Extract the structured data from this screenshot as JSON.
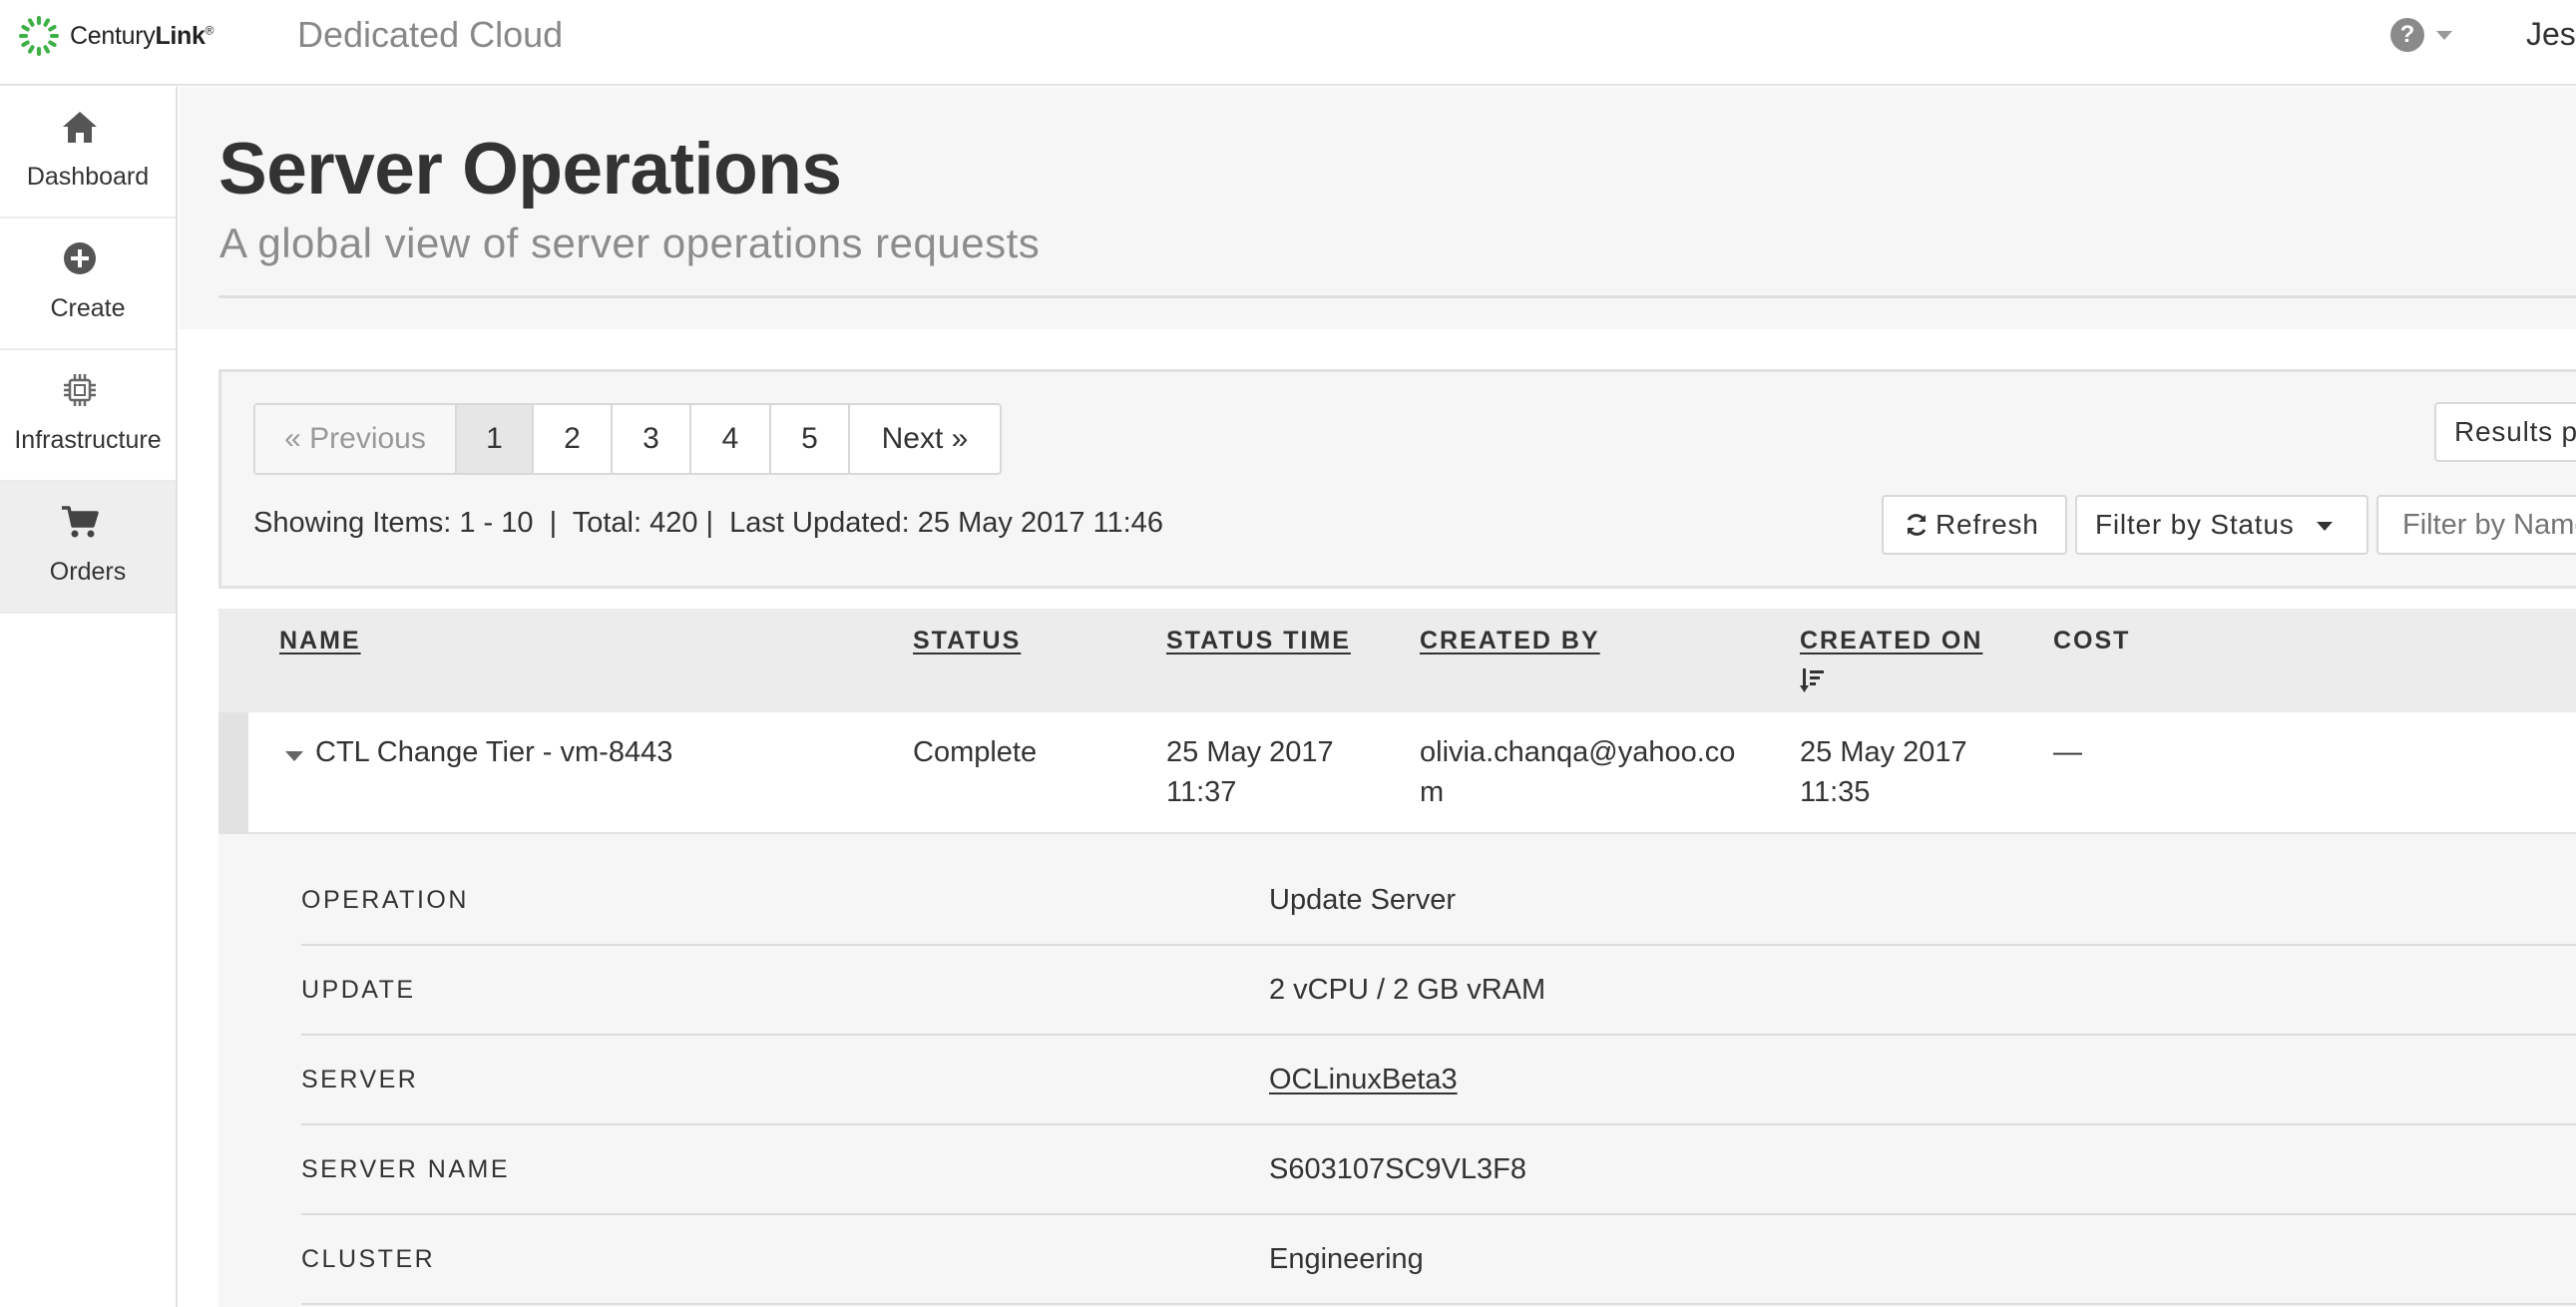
{
  "brand": {
    "logo_text_regular": "Century",
    "logo_text_bold": "Link",
    "logo_mark": "®",
    "app_title": "Dedicated Cloud",
    "accent_color": "#3cb045"
  },
  "header": {
    "help_icon_glyph": "?",
    "user_name": "Jess"
  },
  "sidebar": {
    "items": [
      {
        "label": "Dashboard",
        "icon": "home-icon",
        "active": false
      },
      {
        "label": "Create",
        "icon": "plus-circle-icon",
        "active": false
      },
      {
        "label": "Infrastructure",
        "icon": "chip-icon",
        "active": false
      },
      {
        "label": "Orders",
        "icon": "cart-icon",
        "active": true
      }
    ]
  },
  "page": {
    "title": "Server Operations",
    "subtitle": "A global view of server operations requests"
  },
  "pagination": {
    "previous": "« Previous",
    "pages": [
      "1",
      "2",
      "3",
      "4",
      "5"
    ],
    "current_page": "1",
    "next": "Next »"
  },
  "summary": {
    "text": "Showing Items: 1 - 10  |  Total: 420 |  Last Updated: 25 May 2017 11:46"
  },
  "toolbar": {
    "results_label": "Results p",
    "refresh_label": "Refresh",
    "filter_status_label": "Filter by Status",
    "filter_name_placeholder": "Filter by Name"
  },
  "table": {
    "columns": [
      "NAME",
      "STATUS",
      "STATUS TIME",
      "CREATED BY",
      "CREATED ON",
      "COST"
    ],
    "sorted_column": "CREATED ON",
    "rows": [
      {
        "name": "CTL Change Tier - vm-8443",
        "status": "Complete",
        "status_time_line1": "25 May 2017",
        "status_time_line2": "11:37",
        "created_by_line1": "olivia.chanqa@yahoo.co",
        "created_by_line2": "m",
        "created_on_line1": "25 May 2017",
        "created_on_line2": "11:35",
        "cost": "—",
        "expanded": true
      }
    ]
  },
  "details": [
    {
      "label": "OPERATION",
      "value": "Update Server",
      "link": false
    },
    {
      "label": "UPDATE",
      "value": "2 vCPU / 2 GB vRAM",
      "link": false
    },
    {
      "label": "SERVER",
      "value": "OCLinuxBeta3",
      "link": true
    },
    {
      "label": "SERVER NAME",
      "value": "S603107SC9VL3F8",
      "link": false
    },
    {
      "label": "CLUSTER",
      "value": "Engineering",
      "link": false
    }
  ]
}
